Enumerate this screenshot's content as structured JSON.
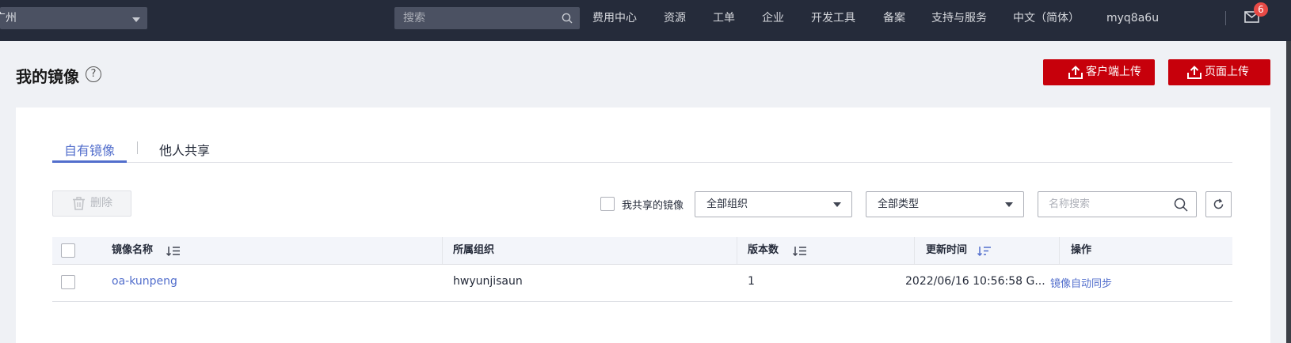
{
  "topbar": {
    "region": "广州",
    "search_placeholder": "搜索",
    "nav": [
      "费用中心",
      "资源",
      "工单",
      "企业",
      "开发工具",
      "备案",
      "支持与服务",
      "中文（简体）",
      "myq8a6u"
    ],
    "mail_badge": "6"
  },
  "header": {
    "title": "我的镜像",
    "help": "?",
    "client_upload": "客户端上传",
    "page_upload": "页面上传"
  },
  "tabs": {
    "own": "自有镜像",
    "shared": "他人共享"
  },
  "toolbar": {
    "delete": "删除",
    "my_shared": "我共享的镜像",
    "org_select": "全部组织",
    "type_select": "全部类型",
    "name_search_placeholder": "名称搜索"
  },
  "table": {
    "columns": [
      "镜像名称",
      "所属组织",
      "版本数",
      "更新时间",
      "操作"
    ],
    "rows": [
      {
        "name": "oa-kunpeng",
        "org": "hwyunjisaun",
        "versions": "1",
        "updated": "2022/06/16 10:56:58 G...",
        "action": "镜像自动同步"
      }
    ]
  },
  "colors": {
    "topbar": "#252b3a",
    "brand_red": "#c7000b",
    "link_blue": "#526ecc",
    "page_bg": "#eff1f5"
  }
}
